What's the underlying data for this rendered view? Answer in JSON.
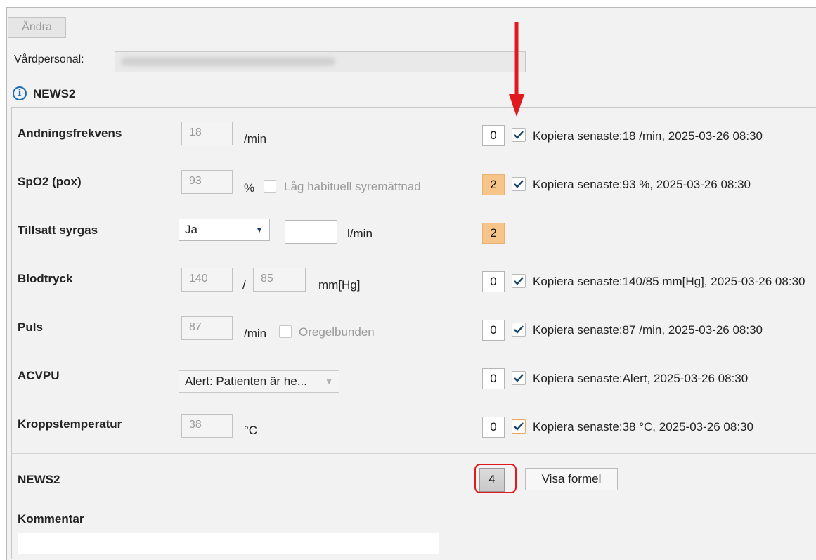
{
  "toolbar": {
    "edit_label": "Ändra"
  },
  "staff": {
    "label": "Vårdpersonal:",
    "value": ""
  },
  "section": {
    "title": "NEWS2"
  },
  "rows": {
    "resp": {
      "label": "Andningsfrekvens",
      "value": "18",
      "unit": "/min",
      "score": "0",
      "copy_checked": true,
      "copy_text": "Kopiera senaste:18 /min, 2025-03-26 08:30"
    },
    "spo2": {
      "label": "SpO2 (pox)",
      "value": "93",
      "unit": "%",
      "option_label": "Låg habituell syremättnad",
      "option_checked": false,
      "score": "2",
      "copy_checked": true,
      "copy_text": "Kopiera senaste:93 %, 2025-03-26 08:30"
    },
    "oxygen": {
      "label": "Tillsatt syrgas",
      "selected": "Ja",
      "flow_value": "",
      "unit": "l/min",
      "score": "2"
    },
    "bp": {
      "label": "Blodtryck",
      "systolic": "140",
      "separator": "/",
      "diastolic": "85",
      "unit": "mm[Hg]",
      "score": "0",
      "copy_checked": true,
      "copy_text": "Kopiera senaste:140/85 mm[Hg], 2025-03-26 08:30"
    },
    "pulse": {
      "label": "Puls",
      "value": "87",
      "unit": "/min",
      "option_label": "Oregelbunden",
      "option_checked": false,
      "score": "0",
      "copy_checked": true,
      "copy_text": "Kopiera senaste:87 /min, 2025-03-26 08:30"
    },
    "acvpu": {
      "label": "ACVPU",
      "selected": "Alert: Patienten är he...",
      "score": "0",
      "copy_checked": true,
      "copy_text": "Kopiera senaste:Alert, 2025-03-26 08:30"
    },
    "temp": {
      "label": "Kroppstemperatur",
      "value": "38",
      "unit": "°C",
      "score": "0",
      "copy_checked": true,
      "copy_text": "Kopiera senaste:38 °C, 2025-03-26 08:30"
    }
  },
  "total": {
    "label": "NEWS2",
    "value": "4",
    "formula_button": "Visa formel"
  },
  "comment": {
    "label": "Kommentar",
    "value": ""
  },
  "colors": {
    "score_warning": "#f7c58a",
    "checkmark": "#17456b",
    "annotation_red": "#e0191e",
    "info_blue": "#1d6fb8"
  }
}
